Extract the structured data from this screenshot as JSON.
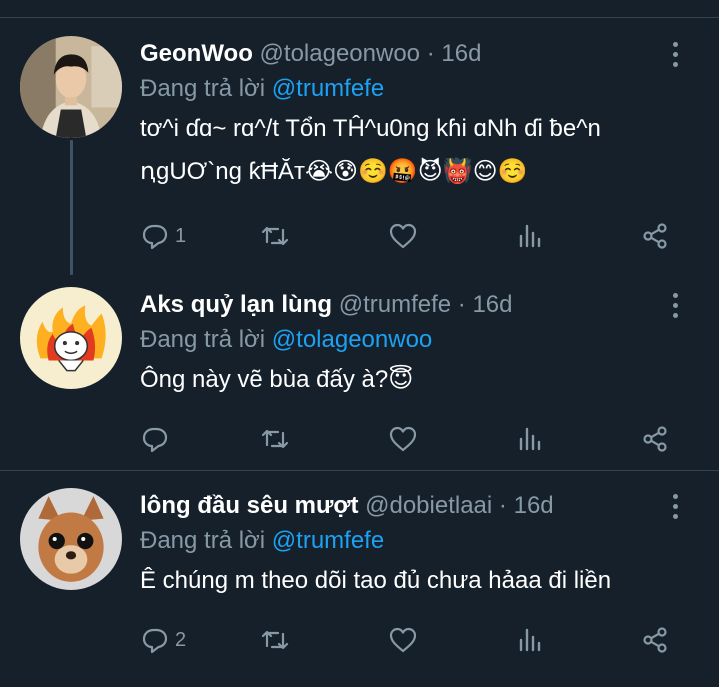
{
  "tweets": [
    {
      "name": "GeonWoo",
      "handle": "@tolageonwoo",
      "separator": "·",
      "time": "16d",
      "reply_prefix": "Đang trả lời",
      "reply_to": "@trumfefe",
      "text_line1": "tơ^i ɗɑ~ rɑ^/t Tổn TĤ^u0ng kɦi ɑNh ɗi ƀe^n",
      "text_line2": "ꞑgUƠ`ng ƙĦĂт",
      "text_emoji": "😭😰☺️🤬😈👹😊☺️",
      "reply_count": "1",
      "avatar_icon": "avatar-photo-man"
    },
    {
      "name": "Aks quỷ lạn lùng",
      "handle": "@trumfefe",
      "separator": "·",
      "time": "16d",
      "reply_prefix": "Đang trả lời",
      "reply_to": "@tolageonwoo",
      "text_line1": "Ông này vẽ bùa đấy à?",
      "text_emoji": "😇",
      "reply_count": "",
      "avatar_icon": "avatar-cartoon-fire"
    },
    {
      "name": "lông đầu sêu mượt",
      "handle": "@dobietlaai",
      "separator": "·",
      "time": "16d",
      "reply_prefix": "Đang trả lời",
      "reply_to": "@trumfefe",
      "text_line1": "Ê chúng m theo dõi tao đủ chưa hảaa đi liền",
      "reply_count": "2",
      "avatar_icon": "avatar-photo-dog"
    }
  ],
  "colors": {
    "background": "#15202b",
    "muted": "#8899a6",
    "accent": "#1da1f2",
    "divider": "#38444d",
    "thread": "#3d5466"
  },
  "icons": [
    "reply-icon",
    "retweet-icon",
    "like-icon",
    "analytics-icon",
    "share-icon",
    "more-icon"
  ]
}
